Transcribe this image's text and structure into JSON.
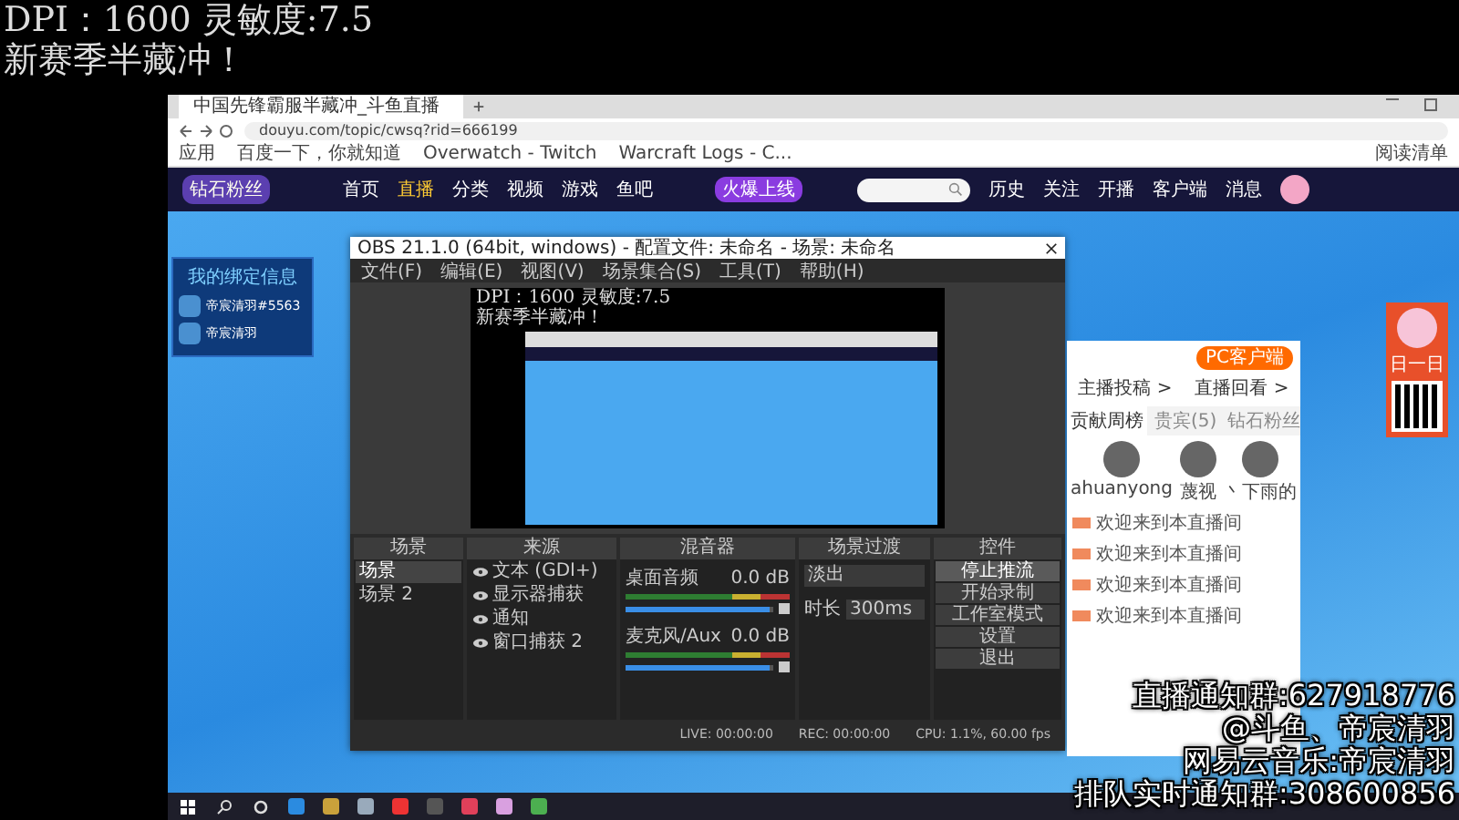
{
  "overlay_top": [
    "DPI：1600 灵敏度:7.5",
    "新赛季半藏冲！"
  ],
  "browser": {
    "tab_title": "中国先锋霸服半藏冲_斗鱼直播",
    "url": "douyu.com/topic/cwsq?rid=666199",
    "reading_list": "阅读清单",
    "bookmarks": [
      {
        "label": "应用"
      },
      {
        "label": "百度一下，你就知道"
      },
      {
        "label": "Overwatch - Twitch"
      },
      {
        "label": "Warcraft Logs - C..."
      }
    ]
  },
  "site": {
    "logo_badge": "钻石粉丝",
    "nav": [
      {
        "label": "首页",
        "selected": false
      },
      {
        "label": "直播",
        "selected": true
      },
      {
        "label": "分类",
        "selected": false
      },
      {
        "label": "视频",
        "selected": false
      },
      {
        "label": "游戏",
        "selected": false
      },
      {
        "label": "鱼吧",
        "selected": false
      }
    ],
    "promo": "火爆上线",
    "actions": [
      "历史",
      "关注",
      "开播",
      "客户端",
      "消息"
    ]
  },
  "bind_card": {
    "title": "我的绑定信息",
    "accounts": [
      "帝宸清羽#5563",
      "帝宸清羽"
    ]
  },
  "obs": {
    "title": "OBS 21.1.0 (64bit, windows) - 配置文件: 未命名 - 场景: 未命名",
    "menu": [
      "文件(F)",
      "编辑(E)",
      "视图(V)",
      "场景集合(S)",
      "工具(T)",
      "帮助(H)"
    ],
    "preview_text": [
      "DPI：1600 灵敏度:7.5",
      "新赛季半藏冲！"
    ],
    "docks": [
      "场景",
      "来源",
      "混音器",
      "场景过渡",
      "控件"
    ],
    "scenes": [
      {
        "name": "场景",
        "selected": true
      },
      {
        "name": "场景 2",
        "selected": false
      }
    ],
    "sources": [
      {
        "name": "文本 (GDI+)",
        "visible": true
      },
      {
        "name": "显示器捕获",
        "visible": true
      },
      {
        "name": "通知",
        "visible": true
      },
      {
        "name": "窗口捕获 2",
        "visible": true
      }
    ],
    "mixer": [
      {
        "name": "桌面音频",
        "reading": "0.0 dB",
        "level": 0.97
      },
      {
        "name": "麦克风/Aux",
        "reading": "0.0 dB",
        "level": 0.97
      }
    ],
    "transition": {
      "value": "淡出",
      "duration_label": "时长",
      "duration": "300ms"
    },
    "controls": [
      {
        "label": "停止推流",
        "active": true
      },
      {
        "label": "开始录制",
        "active": false
      },
      {
        "label": "工作室模式",
        "active": false
      },
      {
        "label": "设置",
        "active": false
      },
      {
        "label": "退出",
        "active": false
      }
    ],
    "status": [
      "LIVE: 00:00:00",
      "REC: 00:00:00",
      "CPU: 1.1%, 60.00 fps"
    ]
  },
  "room_panel": {
    "client_button": "PC客户端",
    "links": [
      "主播投稿 >",
      "直播回看 >"
    ],
    "tabs": [
      {
        "label": "贡献周榜",
        "selected": true
      },
      {
        "label": "贵宾(5)",
        "selected": false
      },
      {
        "label": "钻石粉丝",
        "selected": false
      }
    ],
    "top_fans": [
      {
        "name": "ahuanyong"
      },
      {
        "name": "蔑视"
      },
      {
        "name": "丶下雨的"
      }
    ],
    "chat": [
      {
        "message": "欢迎来到本直播间"
      },
      {
        "message": "欢迎来到本直播间"
      },
      {
        "message": "欢迎来到本直播间"
      },
      {
        "message": "欢迎来到本直播间"
      }
    ]
  },
  "ad": {
    "label": "日一日"
  },
  "overlay_bottom": [
    "直播通知群:627918776",
    "@斗鱼、帝宸清羽",
    "网易云音乐:帝宸清羽",
    "排队实时通知群:308600856"
  ]
}
